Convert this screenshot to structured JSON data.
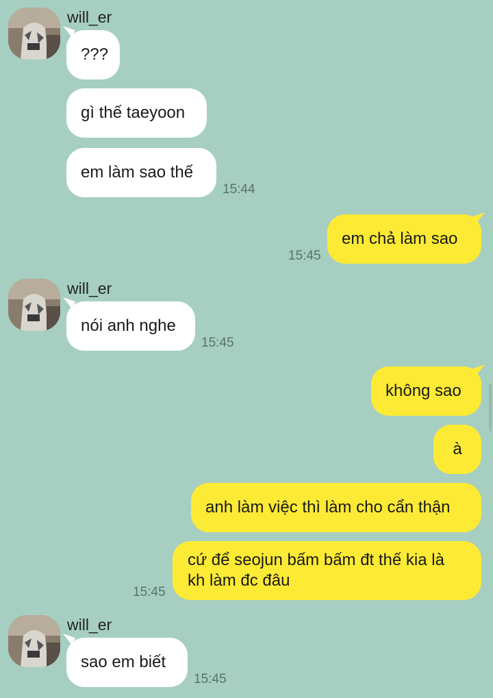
{
  "colors": {
    "background": "#a6cfc1",
    "incoming_bubble": "#ffffff",
    "outgoing_bubble": "#fdea35",
    "timestamp": "#59706a"
  },
  "conversation": {
    "groups": [
      {
        "sender": "will_er",
        "direction": "incoming",
        "messages": [
          "???",
          "gì thế taeyoon",
          "em làm sao thế"
        ],
        "time": "15:44"
      },
      {
        "direction": "outgoing",
        "messages": [
          "em chả làm sao"
        ],
        "time": "15:45"
      },
      {
        "sender": "will_er",
        "direction": "incoming",
        "messages": [
          "nói anh nghe"
        ],
        "time": "15:45"
      },
      {
        "direction": "outgoing",
        "messages": [
          "không sao",
          "à",
          "anh làm việc thì làm cho cẩn thận",
          "cứ để seojun bấm bấm đt thế kia là kh làm đc đâu"
        ],
        "time": "15:45"
      },
      {
        "sender": "will_er",
        "direction": "incoming",
        "messages": [
          "sao em biết"
        ],
        "time": "15:45"
      }
    ]
  }
}
